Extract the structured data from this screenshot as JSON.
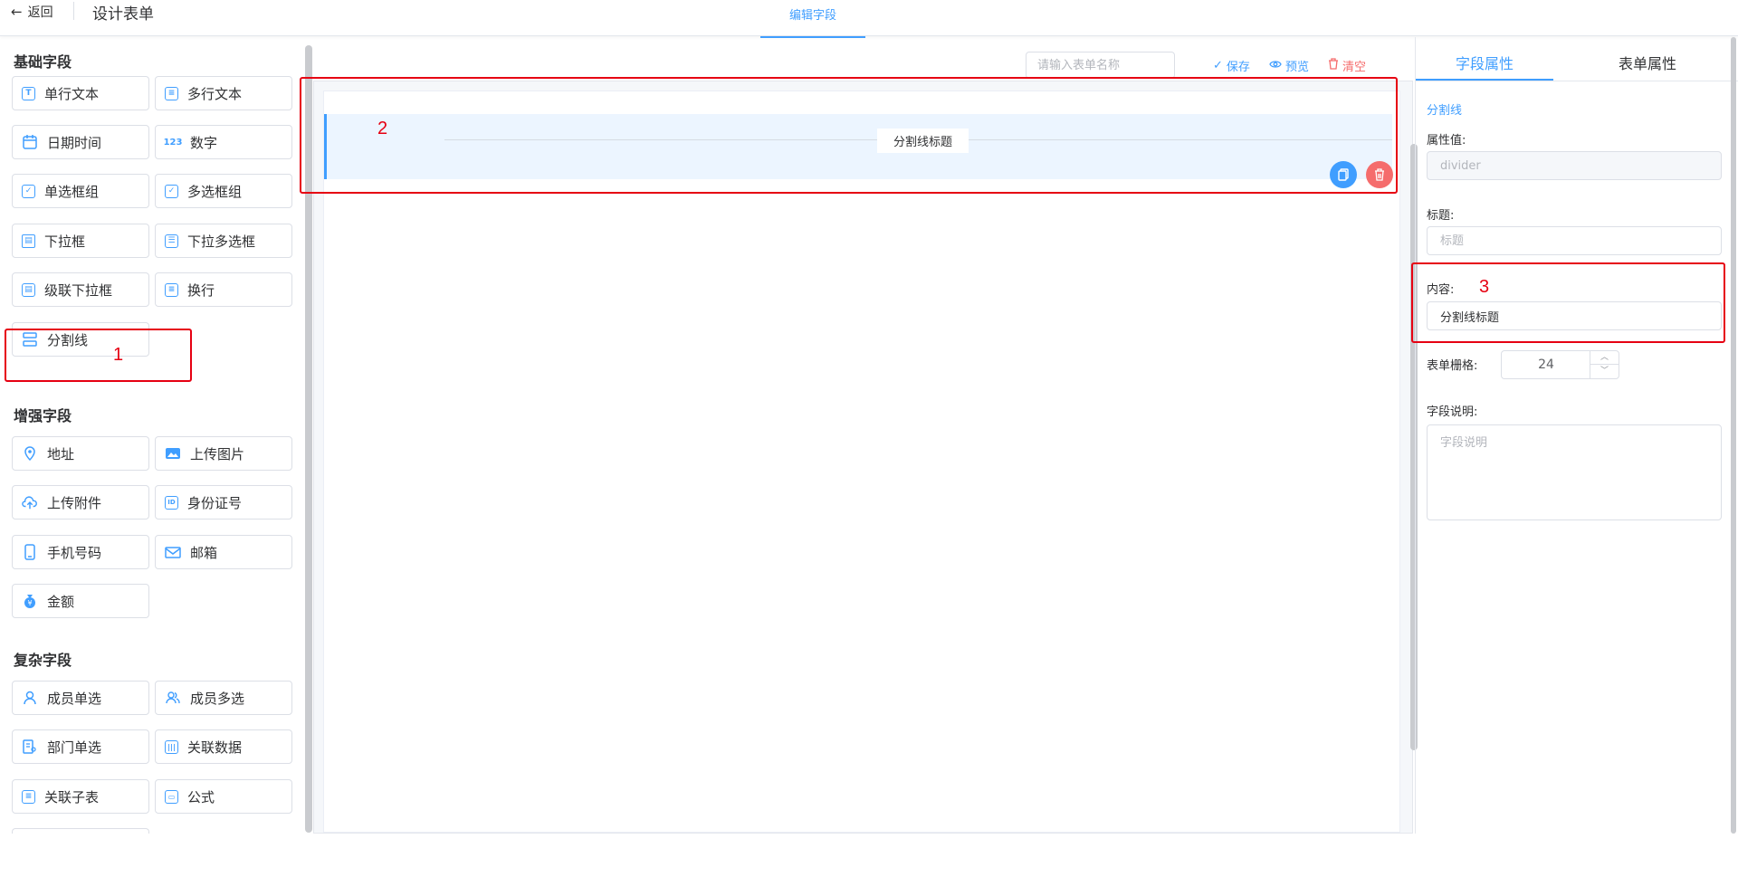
{
  "header": {
    "back_label": "返回",
    "title": "设计表单",
    "center_tab": "编辑字段"
  },
  "left": {
    "groups": [
      {
        "title": "基础字段",
        "items": [
          {
            "label": "单行文本",
            "icon": "text-icon"
          },
          {
            "label": "多行文本",
            "icon": "textarea-icon"
          },
          {
            "label": "日期时间",
            "icon": "calendar-icon"
          },
          {
            "label": "数字",
            "icon": "number-icon"
          },
          {
            "label": "单选框组",
            "icon": "radio-icon"
          },
          {
            "label": "多选框组",
            "icon": "checkbox-icon"
          },
          {
            "label": "下拉框",
            "icon": "select-icon"
          },
          {
            "label": "下拉多选框",
            "icon": "multi-select-icon"
          },
          {
            "label": "级联下拉框",
            "icon": "cascader-icon"
          },
          {
            "label": "换行",
            "icon": "linebreak-icon"
          },
          {
            "label": "分割线",
            "icon": "divider-icon"
          }
        ]
      },
      {
        "title": "增强字段",
        "items": [
          {
            "label": "地址",
            "icon": "location-icon"
          },
          {
            "label": "上传图片",
            "icon": "image-icon"
          },
          {
            "label": "上传附件",
            "icon": "upload-cloud-icon"
          },
          {
            "label": "身份证号",
            "icon": "id-card-icon"
          },
          {
            "label": "手机号码",
            "icon": "phone-icon"
          },
          {
            "label": "邮箱",
            "icon": "mail-icon"
          },
          {
            "label": "金额",
            "icon": "money-bag-icon"
          }
        ]
      },
      {
        "title": "复杂字段",
        "items": [
          {
            "label": "成员单选",
            "icon": "user-icon"
          },
          {
            "label": "成员多选",
            "icon": "users-icon"
          },
          {
            "label": "部门单选",
            "icon": "department-icon"
          },
          {
            "label": "关联数据",
            "icon": "link-data-icon"
          },
          {
            "label": "关联子表",
            "icon": "subtable-icon"
          },
          {
            "label": "公式",
            "icon": "formula-icon"
          }
        ]
      }
    ]
  },
  "toolbar": {
    "form_name_placeholder": "请输入表单名称",
    "save_label": "保存",
    "preview_label": "预览",
    "clear_label": "清空"
  },
  "canvas": {
    "divider_text": "分割线标题"
  },
  "right": {
    "tabs": [
      "字段属性",
      "表单属性"
    ],
    "field_type": "分割线",
    "attr_label": "属性值:",
    "attr_value": "divider",
    "title_label": "标题:",
    "title_placeholder": "标题",
    "content_label": "内容:",
    "content_value": "分割线标题",
    "grid_label": "表单栅格:",
    "grid_value": "24",
    "desc_label": "字段说明:",
    "desc_placeholder": "字段说明"
  },
  "annotations": [
    "1",
    "2",
    "3"
  ],
  "colors": {
    "accent": "#409eff",
    "danger": "#f56c6c",
    "annotation": "#e60012"
  }
}
